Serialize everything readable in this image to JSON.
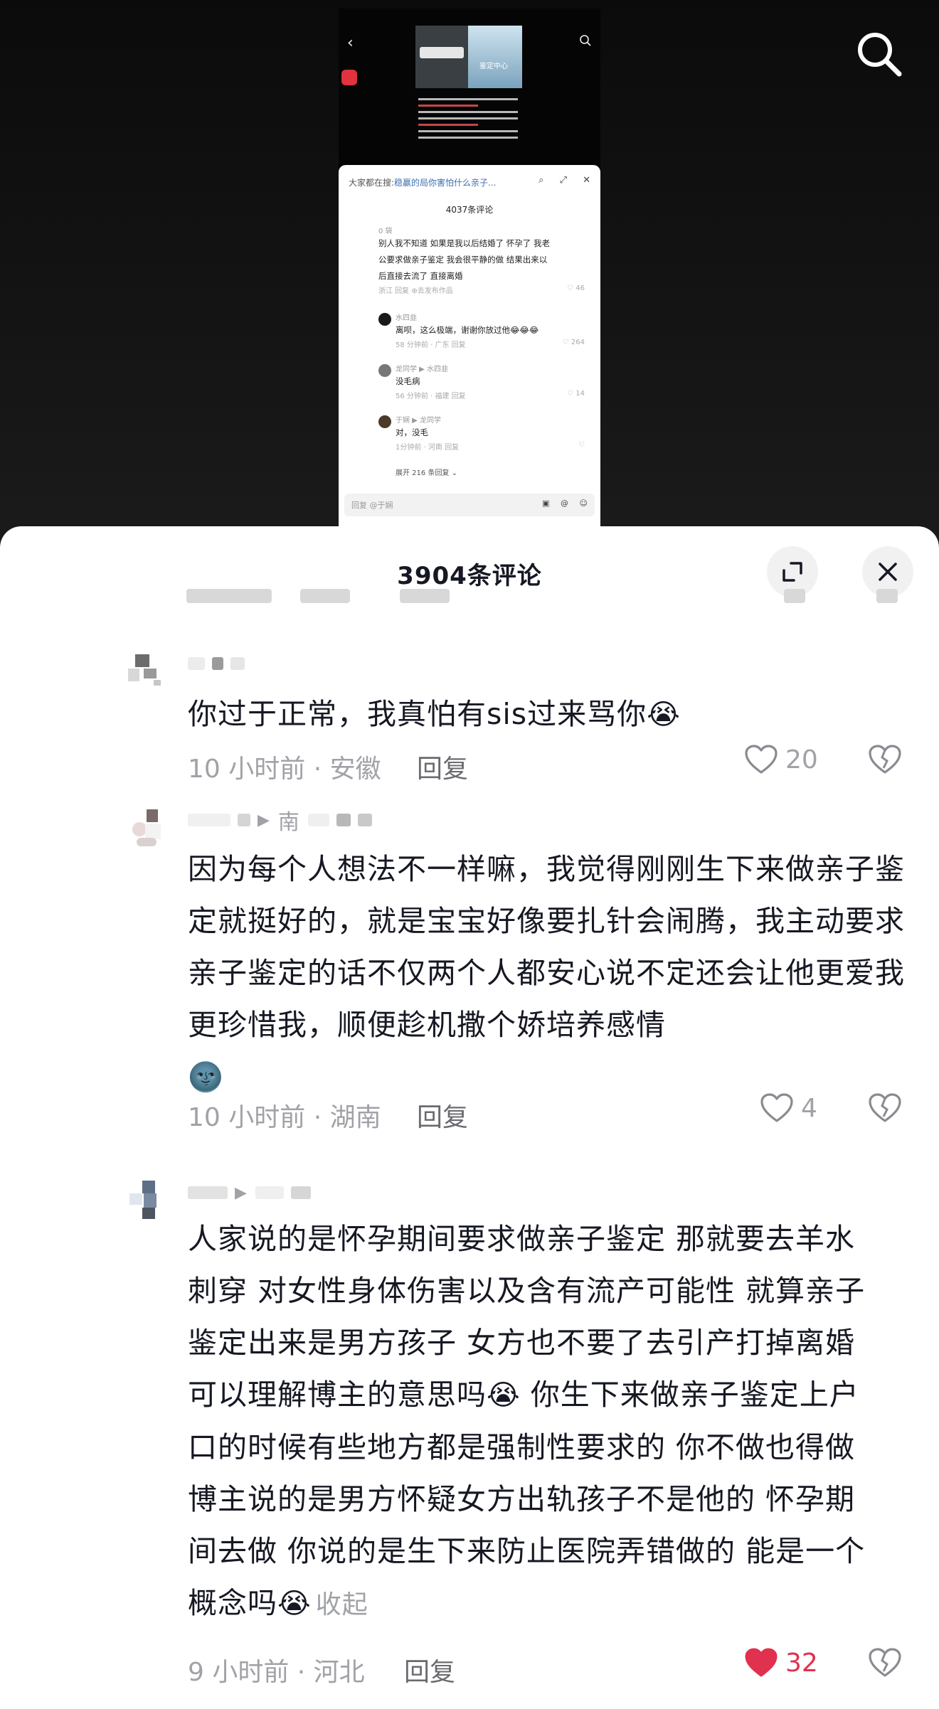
{
  "video_preview": {
    "thumb_caption": "鉴定中心",
    "search_hint_prefix": "大家都在搜:",
    "search_hint": "稳赢的局你害怕什么亲子...",
    "comment_count": "4037条评论",
    "comments": [
      {
        "name": "0 袋",
        "text_lines": [
          "别人我不知道 如果是我以后结婚了 怀孕了  我老",
          "公要求做亲子鉴定  我会很平静的做  结果出来以",
          "后直接去流了 直接离婚"
        ],
        "meta": "浙江    回复    ⊕去发布作品",
        "likes": "46"
      },
      {
        "name": "水四韭",
        "text": "离呗，这么极端，谢谢你放过他😂😂😂",
        "meta": "58 分钟前 · 广东    回复",
        "likes": "264"
      },
      {
        "name": "龙同学 ▶ 水四韭",
        "text": "没毛病",
        "meta": "56 分钟前 · 福建    回复",
        "likes": "14"
      },
      {
        "name": "于娴 ▶ 龙同学",
        "text": "对，没毛",
        "meta": "1分钟前 · 河南    回复",
        "likes": ""
      }
    ],
    "expand_replies": "展开 216 条回复 ⌄",
    "reply_placeholder": "回复 @于娴"
  },
  "sheet": {
    "title": "3904条评论"
  },
  "comments": [
    {
      "text": "你过于正常，我真怕有sis过来骂你",
      "emoji": "😭",
      "time": "10 小时前 · 安徽",
      "reply_label": "回复",
      "likes": "20",
      "liked": false
    },
    {
      "reply_to": "南",
      "text": "因为每个人想法不一样嘛，我觉得刚刚生下来做亲子鉴定就挺好的，就是宝宝好像要扎针会闹腾，我主动要求亲子鉴定的话不仅两个人都安心说不定还会让他更爱我更珍惜我，顺便趁机撒个娇培养感情",
      "emoji": "🌚",
      "time": "10 小时前 · 湖南",
      "reply_label": "回复",
      "likes": "4",
      "liked": false
    },
    {
      "text_lines": [
        "人家说的是怀孕期间要求做亲子鉴定 那就要去羊水",
        "刺穿 对女性身体伤害以及含有流产可能性  就算亲子",
        "鉴定出来是男方孩子 女方也不要了去引产打掉离婚",
        "可以理解博主的意思吗",
        "你生下来做亲子鉴定上户",
        "口的时候有些地方都是强制性要求的 你不做也得做",
        "博主说的是男方怀疑女方出轨孩子不是他的 怀孕期",
        "间去做 你说的是生下来防止医院弄错做的 能是一个",
        "概念吗"
      ],
      "emoji": "😭",
      "collapse_label": "收起",
      "time": "9 小时前 · 河北",
      "reply_label": "回复",
      "likes": "32",
      "liked": true
    }
  ],
  "colors": {
    "liked": "#e0314e",
    "secondary_text": "#a1a2a7",
    "primary_text": "#161823"
  }
}
